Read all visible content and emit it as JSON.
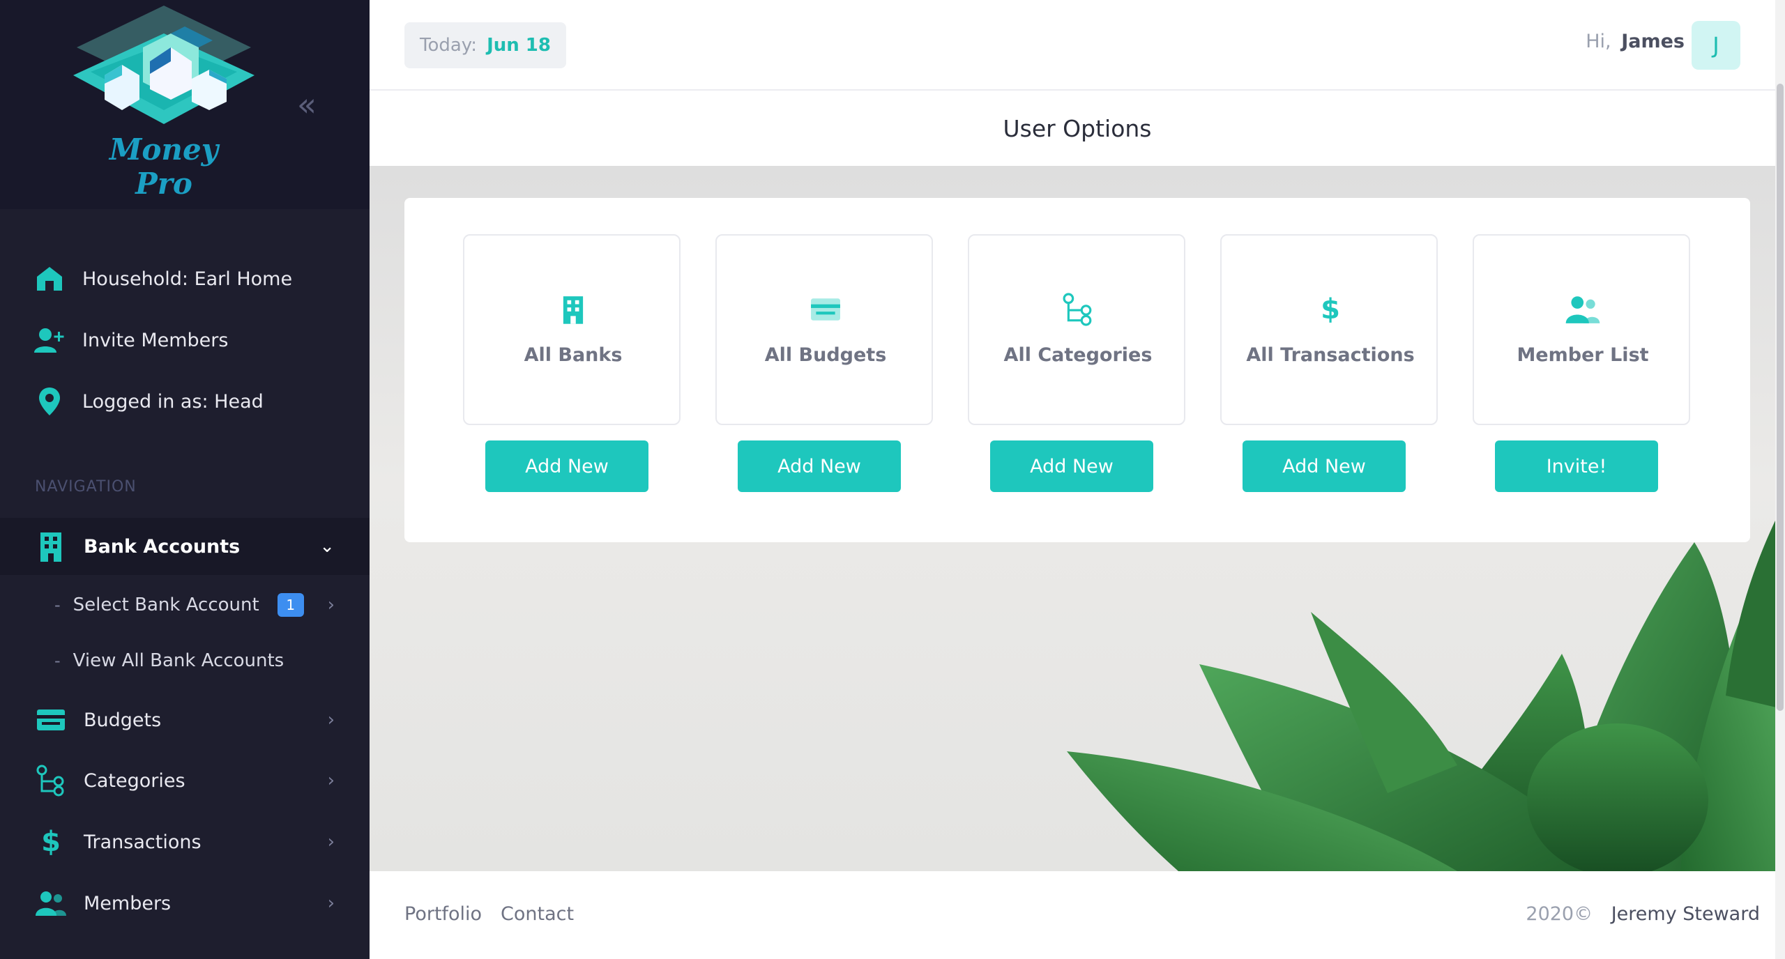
{
  "brand": {
    "name": "Money Pro"
  },
  "sidebar": {
    "info": [
      {
        "label": "Household: Earl Home",
        "icon": "home-icon"
      },
      {
        "label": "Invite Members",
        "icon": "user-plus-icon"
      },
      {
        "label": "Logged in as: Head",
        "icon": "map-pin-icon"
      }
    ],
    "nav_heading": "NAVIGATION",
    "nav": [
      {
        "label": "Bank Accounts",
        "icon": "bank-building-icon",
        "expanded": true
      },
      {
        "label": "Budgets",
        "icon": "budget-card-icon"
      },
      {
        "label": "Categories",
        "icon": "categories-tree-icon"
      },
      {
        "label": "Transactions",
        "icon": "dollar-icon"
      },
      {
        "label": "Members",
        "icon": "members-icon"
      }
    ],
    "sub": [
      {
        "dash": "-",
        "label": "Select Bank Account",
        "badge": "1"
      },
      {
        "dash": "-",
        "label": "View All Bank Accounts"
      }
    ]
  },
  "topbar": {
    "today_label": "Today:",
    "today_value": "Jun 18",
    "greeting": "Hi,",
    "user_name": "James",
    "avatar_initial": "J"
  },
  "page": {
    "title": "User Options"
  },
  "options": [
    {
      "label": "All Banks",
      "icon": "bank-building-icon",
      "button": "Add New"
    },
    {
      "label": "All Budgets",
      "icon": "budget-card-icon",
      "button": "Add New"
    },
    {
      "label": "All Categories",
      "icon": "categories-tree-icon",
      "button": "Add New"
    },
    {
      "label": "All Transactions",
      "icon": "dollar-icon",
      "button": "Add New"
    },
    {
      "label": "Member List",
      "icon": "members-icon",
      "button": "Invite!"
    }
  ],
  "footer": {
    "links": [
      "Portfolio",
      "Contact"
    ],
    "year": "2020©",
    "author": "Jeremy Steward"
  },
  "colors": {
    "accent": "#1ec7bd",
    "sidebar_bg": "#1e1e2e",
    "badge": "#3d8ef0"
  }
}
